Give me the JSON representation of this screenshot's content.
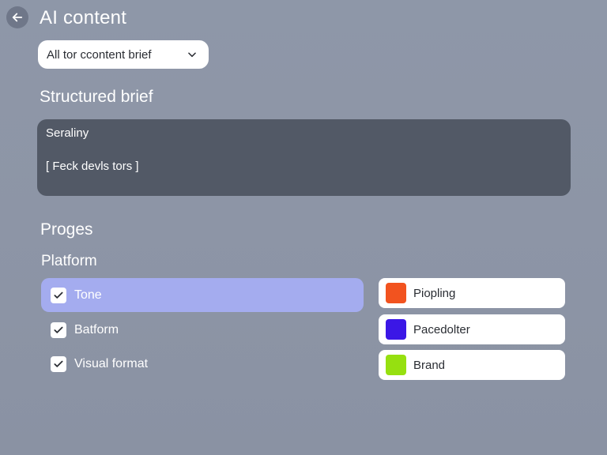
{
  "header": {
    "back_icon": "arrow-left-icon",
    "title": "AI content"
  },
  "dropdown": {
    "selected": "All tor ccontent brief",
    "chevron_icon": "chevron-down-icon"
  },
  "structured_brief": {
    "heading": "Structured brief",
    "label": "Seraliny",
    "value": "[ Feck devls tors ]"
  },
  "progress": {
    "heading": "Proges",
    "subheading": "Platform"
  },
  "checklist": [
    {
      "label": "Tone",
      "checked": true,
      "active": true
    },
    {
      "label": "Batform",
      "checked": true,
      "active": false
    },
    {
      "label": "Visual format",
      "checked": true,
      "active": false
    }
  ],
  "swatches": [
    {
      "label": "Piopling",
      "color": "#f2531f"
    },
    {
      "label": "Pacedolter",
      "color": "#3b17e6"
    },
    {
      "label": "Brand",
      "color": "#96e010"
    }
  ],
  "colors": {
    "background": "#8d95a6",
    "brief_panel": "#525966",
    "active_row": "#a4acef"
  }
}
